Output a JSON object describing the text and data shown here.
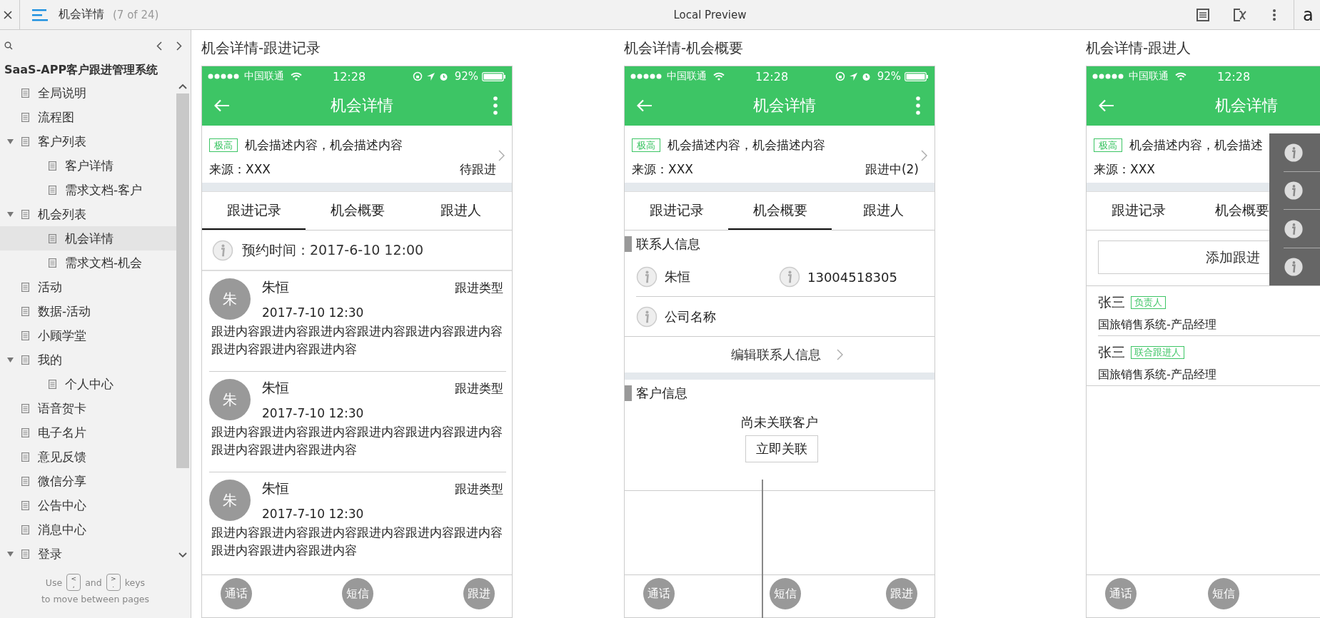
{
  "top_bar": {
    "page_title": "机会详情",
    "page_count": "(7 of 24)",
    "title": "Local Preview",
    "logo": "a"
  },
  "sidebar": {
    "project": "SaaS-APP客户跟进管理系统",
    "items": [
      {
        "label": "全局说明",
        "selected": false
      },
      {
        "label": "流程图",
        "selected": false
      },
      {
        "label": "客户列表",
        "selected": false,
        "expanded": true,
        "children": [
          {
            "label": "客户详情",
            "selected": false
          },
          {
            "label": "需求文档-客户",
            "selected": false
          }
        ]
      },
      {
        "label": "机会列表",
        "selected": false,
        "expanded": true,
        "children": [
          {
            "label": "机会详情",
            "selected": true
          },
          {
            "label": "需求文档-机会",
            "selected": false
          }
        ]
      },
      {
        "label": "活动",
        "selected": false
      },
      {
        "label": "数据-活动",
        "selected": false
      },
      {
        "label": "小顾学堂",
        "selected": false
      },
      {
        "label": "我的",
        "selected": false,
        "expanded": true,
        "children": [
          {
            "label": "个人中心",
            "selected": false
          }
        ]
      },
      {
        "label": "语音贺卡",
        "selected": false
      },
      {
        "label": "电子名片",
        "selected": false
      },
      {
        "label": "意见反馈",
        "selected": false
      },
      {
        "label": "微信分享",
        "selected": false
      },
      {
        "label": "公告中心",
        "selected": false
      },
      {
        "label": "消息中心",
        "selected": false
      },
      {
        "label": "登录",
        "selected": false,
        "expanded": true
      }
    ],
    "footer": {
      "use": "Use",
      "key_prev": [
        "<",
        ","
      ],
      "and": "and",
      "key_next": [
        ">",
        "."
      ],
      "keys": "keys",
      "hint": "to move between pages"
    }
  },
  "screens": [
    {
      "title": "机会详情-跟进记录",
      "status_bar": {
        "carrier": "中国联通",
        "time": "12:28",
        "battery": "92%"
      },
      "nav_title": "机会详情",
      "priority": "极高",
      "description": "机会描述内容，机会描述内容",
      "source": "来源：XXX",
      "state": "待跟进",
      "menu_open": false,
      "tabs": [
        {
          "label": "跟进记录",
          "selected": true
        },
        {
          "label": "机会概要",
          "selected": false
        },
        {
          "label": "跟进人",
          "selected": false
        }
      ],
      "content": {
        "kind": "records",
        "appointment": "预约时间：2017-6-10 12:00",
        "records": [
          {
            "avatar": "朱",
            "name": "朱恒",
            "type": "跟进类型",
            "time": "2017-7-10 12:30",
            "text": "跟进内容跟进内容跟进内容跟进内容跟进内容跟进内容跟进内容跟进内容跟进内容"
          },
          {
            "avatar": "朱",
            "name": "朱恒",
            "type": "跟进类型",
            "time": "2017-7-10 12:30",
            "text": "跟进内容跟进内容跟进内容跟进内容跟进内容跟进内容跟进内容跟进内容跟进内容"
          },
          {
            "avatar": "朱",
            "name": "朱恒",
            "type": "跟进类型",
            "time": "2017-7-10 12:30",
            "text": "跟进内容跟进内容跟进内容跟进内容跟进内容跟进内容跟进内容跟进内容跟进内容"
          }
        ]
      },
      "actions": [
        "通话",
        "短信",
        "跟进"
      ]
    },
    {
      "title": "机会详情-机会概要",
      "status_bar": {
        "carrier": "中国联通",
        "time": "12:28",
        "battery": "92%"
      },
      "nav_title": "机会详情",
      "priority": "极高",
      "description": "机会描述内容，机会描述内容",
      "source": "来源：XXX",
      "state": "跟进中(2)",
      "menu_open": false,
      "tabs": [
        {
          "label": "跟进记录",
          "selected": false
        },
        {
          "label": "机会概要",
          "selected": true
        },
        {
          "label": "跟进人",
          "selected": false
        }
      ],
      "content": {
        "kind": "summary",
        "contact_heading": "联系人信息",
        "contact_name": "朱恒",
        "contact_phone": "13004518305",
        "company": "公司名称",
        "edit_link": "编辑联系人信息",
        "customer_heading": "客户信息",
        "empty_text": "尚未关联客户",
        "link_button": "立即关联"
      },
      "actions": [
        "通话",
        "短信",
        "跟进"
      ]
    },
    {
      "title": "机会详情-跟进人",
      "status_bar": {
        "carrier": "中国联通",
        "time": "12:28"
      },
      "nav_title": "机会详情",
      "priority": "极高",
      "description": "机会描述内容，机会描述",
      "source": "来源：XXX",
      "menu_open": true,
      "tabs": [
        {
          "label": "跟进记录",
          "selected": false
        },
        {
          "label": "机会概要",
          "selected": false
        }
      ],
      "content": {
        "kind": "followers",
        "add_button": "添加跟进",
        "people": [
          {
            "name": "张三",
            "role": "负责人",
            "title": "国旅销售系统-产品经理"
          },
          {
            "name": "张三",
            "role": "联合跟进人",
            "title": "国旅销售系统-产品经理"
          }
        ]
      },
      "actions": [
        "通话",
        "短信"
      ]
    }
  ]
}
